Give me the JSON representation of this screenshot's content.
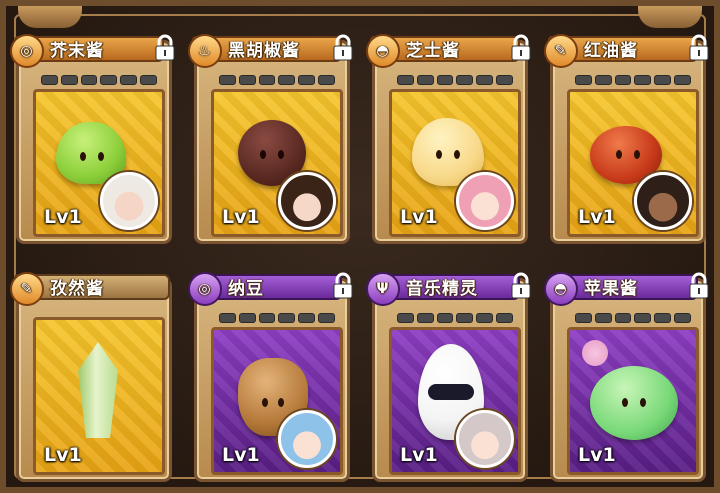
{
  "cards": [
    {
      "name": "芥末酱",
      "level": "Lv1",
      "rarity": "gold",
      "icon": "dish-icon",
      "locked": true,
      "blob_color": "#8ccf3a"
    },
    {
      "name": "黑胡椒酱",
      "level": "Lv1",
      "rarity": "gold",
      "icon": "bowl-icon",
      "locked": true,
      "blob_color": "#5a2a22"
    },
    {
      "name": "芝士酱",
      "level": "Lv1",
      "rarity": "gold",
      "icon": "cake-icon",
      "locked": true,
      "blob_color": "#f8d98a"
    },
    {
      "name": "红油酱",
      "level": "Lv1",
      "rarity": "gold",
      "icon": "knife-icon",
      "locked": true,
      "blob_color": "#c73a1a"
    },
    {
      "name": "孜然酱",
      "level": "Lv1",
      "rarity": "gold",
      "icon": "knife-icon",
      "locked": false,
      "blob_color": "#c7e6a2"
    },
    {
      "name": "纳豆",
      "level": "Lv1",
      "rarity": "purple",
      "icon": "dish-icon",
      "locked": true,
      "blob_color": "#b57a3a"
    },
    {
      "name": "音乐精灵",
      "level": "Lv1",
      "rarity": "purple",
      "icon": "fork-icon",
      "locked": true,
      "blob_color": "#f4f4f4"
    },
    {
      "name": "苹果酱",
      "level": "Lv1",
      "rarity": "purple",
      "icon": "cake-icon",
      "locked": true,
      "blob_color": "#79d978"
    }
  ]
}
